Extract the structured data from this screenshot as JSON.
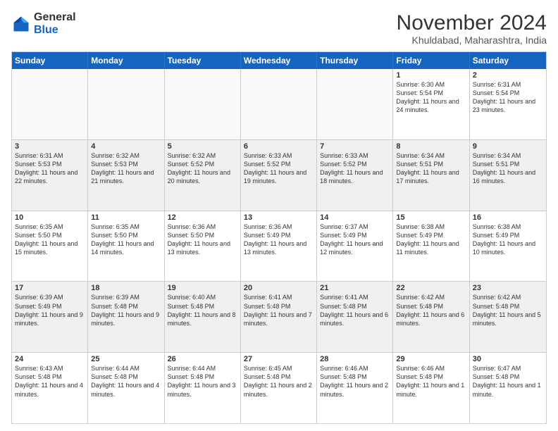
{
  "logo": {
    "general": "General",
    "blue": "Blue"
  },
  "title": "November 2024",
  "subtitle": "Khuldabad, Maharashtra, India",
  "header_days": [
    "Sunday",
    "Monday",
    "Tuesday",
    "Wednesday",
    "Thursday",
    "Friday",
    "Saturday"
  ],
  "rows": [
    [
      {
        "day": "",
        "detail": "",
        "empty": true
      },
      {
        "day": "",
        "detail": "",
        "empty": true
      },
      {
        "day": "",
        "detail": "",
        "empty": true
      },
      {
        "day": "",
        "detail": "",
        "empty": true
      },
      {
        "day": "",
        "detail": "",
        "empty": true
      },
      {
        "day": "1",
        "detail": "Sunrise: 6:30 AM\nSunset: 5:54 PM\nDaylight: 11 hours\nand 24 minutes.",
        "empty": false
      },
      {
        "day": "2",
        "detail": "Sunrise: 6:31 AM\nSunset: 5:54 PM\nDaylight: 11 hours\nand 23 minutes.",
        "empty": false
      }
    ],
    [
      {
        "day": "3",
        "detail": "Sunrise: 6:31 AM\nSunset: 5:53 PM\nDaylight: 11 hours\nand 22 minutes.",
        "empty": false
      },
      {
        "day": "4",
        "detail": "Sunrise: 6:32 AM\nSunset: 5:53 PM\nDaylight: 11 hours\nand 21 minutes.",
        "empty": false
      },
      {
        "day": "5",
        "detail": "Sunrise: 6:32 AM\nSunset: 5:52 PM\nDaylight: 11 hours\nand 20 minutes.",
        "empty": false
      },
      {
        "day": "6",
        "detail": "Sunrise: 6:33 AM\nSunset: 5:52 PM\nDaylight: 11 hours\nand 19 minutes.",
        "empty": false
      },
      {
        "day": "7",
        "detail": "Sunrise: 6:33 AM\nSunset: 5:52 PM\nDaylight: 11 hours\nand 18 minutes.",
        "empty": false
      },
      {
        "day": "8",
        "detail": "Sunrise: 6:34 AM\nSunset: 5:51 PM\nDaylight: 11 hours\nand 17 minutes.",
        "empty": false
      },
      {
        "day": "9",
        "detail": "Sunrise: 6:34 AM\nSunset: 5:51 PM\nDaylight: 11 hours\nand 16 minutes.",
        "empty": false
      }
    ],
    [
      {
        "day": "10",
        "detail": "Sunrise: 6:35 AM\nSunset: 5:50 PM\nDaylight: 11 hours\nand 15 minutes.",
        "empty": false
      },
      {
        "day": "11",
        "detail": "Sunrise: 6:35 AM\nSunset: 5:50 PM\nDaylight: 11 hours\nand 14 minutes.",
        "empty": false
      },
      {
        "day": "12",
        "detail": "Sunrise: 6:36 AM\nSunset: 5:50 PM\nDaylight: 11 hours\nand 13 minutes.",
        "empty": false
      },
      {
        "day": "13",
        "detail": "Sunrise: 6:36 AM\nSunset: 5:49 PM\nDaylight: 11 hours\nand 13 minutes.",
        "empty": false
      },
      {
        "day": "14",
        "detail": "Sunrise: 6:37 AM\nSunset: 5:49 PM\nDaylight: 11 hours\nand 12 minutes.",
        "empty": false
      },
      {
        "day": "15",
        "detail": "Sunrise: 6:38 AM\nSunset: 5:49 PM\nDaylight: 11 hours\nand 11 minutes.",
        "empty": false
      },
      {
        "day": "16",
        "detail": "Sunrise: 6:38 AM\nSunset: 5:49 PM\nDaylight: 11 hours\nand 10 minutes.",
        "empty": false
      }
    ],
    [
      {
        "day": "17",
        "detail": "Sunrise: 6:39 AM\nSunset: 5:49 PM\nDaylight: 11 hours\nand 9 minutes.",
        "empty": false
      },
      {
        "day": "18",
        "detail": "Sunrise: 6:39 AM\nSunset: 5:48 PM\nDaylight: 11 hours\nand 9 minutes.",
        "empty": false
      },
      {
        "day": "19",
        "detail": "Sunrise: 6:40 AM\nSunset: 5:48 PM\nDaylight: 11 hours\nand 8 minutes.",
        "empty": false
      },
      {
        "day": "20",
        "detail": "Sunrise: 6:41 AM\nSunset: 5:48 PM\nDaylight: 11 hours\nand 7 minutes.",
        "empty": false
      },
      {
        "day": "21",
        "detail": "Sunrise: 6:41 AM\nSunset: 5:48 PM\nDaylight: 11 hours\nand 6 minutes.",
        "empty": false
      },
      {
        "day": "22",
        "detail": "Sunrise: 6:42 AM\nSunset: 5:48 PM\nDaylight: 11 hours\nand 6 minutes.",
        "empty": false
      },
      {
        "day": "23",
        "detail": "Sunrise: 6:42 AM\nSunset: 5:48 PM\nDaylight: 11 hours\nand 5 minutes.",
        "empty": false
      }
    ],
    [
      {
        "day": "24",
        "detail": "Sunrise: 6:43 AM\nSunset: 5:48 PM\nDaylight: 11 hours\nand 4 minutes.",
        "empty": false
      },
      {
        "day": "25",
        "detail": "Sunrise: 6:44 AM\nSunset: 5:48 PM\nDaylight: 11 hours\nand 4 minutes.",
        "empty": false
      },
      {
        "day": "26",
        "detail": "Sunrise: 6:44 AM\nSunset: 5:48 PM\nDaylight: 11 hours\nand 3 minutes.",
        "empty": false
      },
      {
        "day": "27",
        "detail": "Sunrise: 6:45 AM\nSunset: 5:48 PM\nDaylight: 11 hours\nand 2 minutes.",
        "empty": false
      },
      {
        "day": "28",
        "detail": "Sunrise: 6:46 AM\nSunset: 5:48 PM\nDaylight: 11 hours\nand 2 minutes.",
        "empty": false
      },
      {
        "day": "29",
        "detail": "Sunrise: 6:46 AM\nSunset: 5:48 PM\nDaylight: 11 hours\nand 1 minute.",
        "empty": false
      },
      {
        "day": "30",
        "detail": "Sunrise: 6:47 AM\nSunset: 5:48 PM\nDaylight: 11 hours\nand 1 minute.",
        "empty": false
      }
    ]
  ]
}
